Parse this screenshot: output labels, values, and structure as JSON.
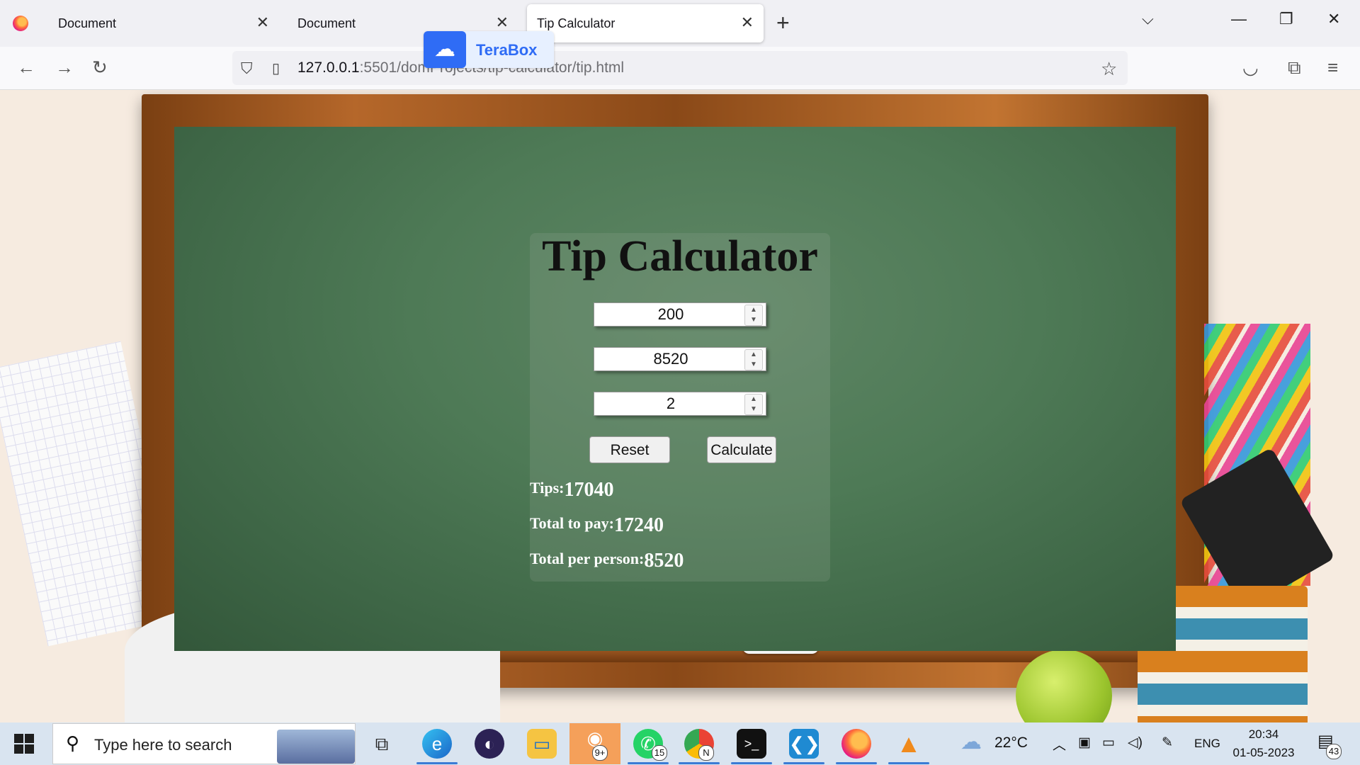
{
  "browser": {
    "tabs": [
      {
        "label": "Document"
      },
      {
        "label": "Document"
      },
      {
        "label": "Tip Calculator"
      }
    ],
    "url_host": "127.0.0.1",
    "url_rest": ":5501/domProjects/tip-calculator/tip.html",
    "terabox_label": "TeraBox"
  },
  "app": {
    "title": "Tip Calculator",
    "inputs": {
      "bill": "200",
      "tip": "8520",
      "people": "2"
    },
    "buttons": {
      "reset": "Reset",
      "calculate": "Calculate"
    },
    "results": {
      "tips_label": "Tips:",
      "tips_value": "17040",
      "total_label": "Total to pay:",
      "total_value": "17240",
      "per_person_label": "Total per person:",
      "per_person_value": "8520"
    }
  },
  "taskbar": {
    "search_placeholder": "Type here to search",
    "whatsapp_badge": "15",
    "photos_badge": "9+",
    "chrome_badge": "N",
    "weather": "22°C",
    "lang": "ENG",
    "time": "20:34",
    "date": "01-05-2023",
    "notifications": "43"
  },
  "colors": {
    "board_green": "#4e7a56",
    "result_text": "#ffffff",
    "terabox_blue": "#2f6cf5"
  }
}
